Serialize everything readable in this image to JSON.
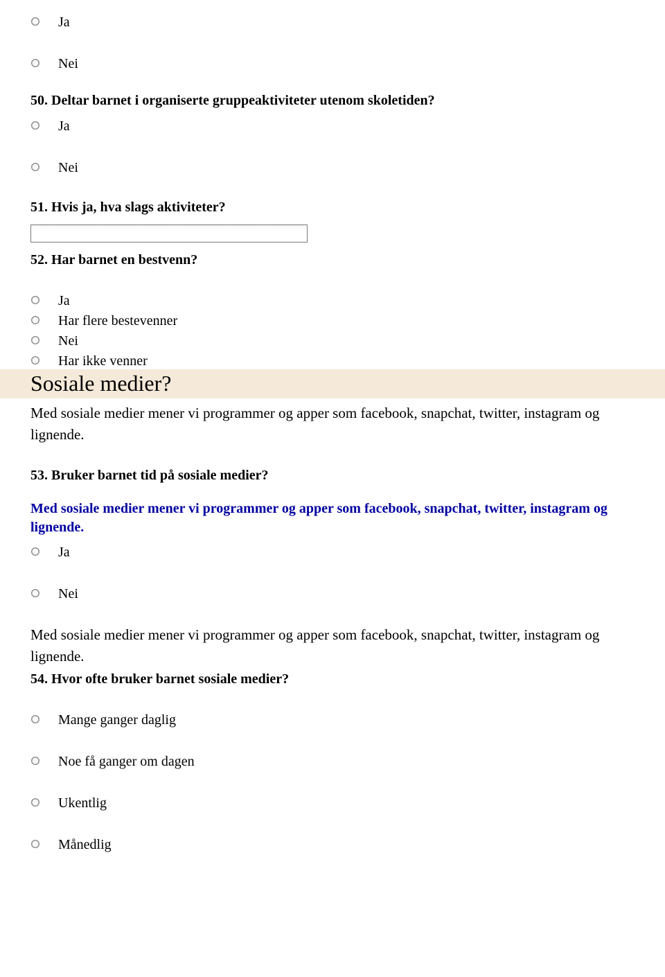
{
  "top_options": {
    "ja": "Ja",
    "nei": "Nei"
  },
  "q50": {
    "title": "50. Deltar barnet i organiserte gruppeaktiviteter utenom skoletiden?",
    "opt_ja": "Ja",
    "opt_nei": "Nei"
  },
  "q51": {
    "title": "51. Hvis ja, hva slags aktiviteter?",
    "value": ""
  },
  "q52": {
    "title": "52. Har barnet en bestvenn?",
    "opt_ja": "Ja",
    "opt_flere": "Har flere bestevenner",
    "opt_nei": "Nei",
    "opt_ikke": "Har ikke venner"
  },
  "section": {
    "heading": "Sosiale medier?",
    "intro": "Med sosiale medier mener vi programmer og apper som facebook, snapchat, twitter, instagram og lignende."
  },
  "q53": {
    "title": "53. Bruker barnet tid på sosiale medier?",
    "blue": "Med sosiale medier mener vi programmer og apper som facebook, snapchat, twitter, instagram og lignende.",
    "opt_ja": "Ja",
    "opt_nei": "Nei"
  },
  "q54": {
    "pretext": "Med sosiale medier mener vi programmer og apper som facebook, snapchat, twitter, instagram og lignende.",
    "title": "54. Hvor ofte bruker barnet sosiale medier?",
    "opt1": "Mange ganger daglig",
    "opt2": "Noe få ganger om dagen",
    "opt3": "Ukentlig",
    "opt4": "Månedlig"
  }
}
